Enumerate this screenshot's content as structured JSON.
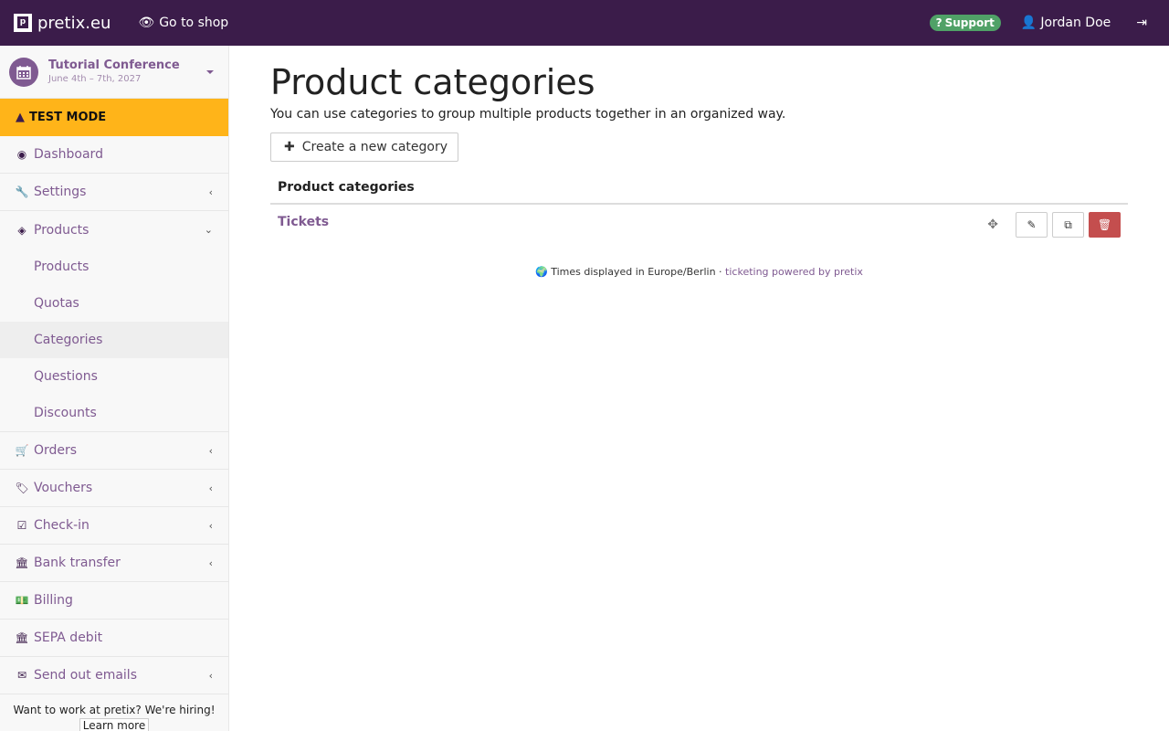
{
  "topbar": {
    "brand": "pretix.eu",
    "go_to_shop": "Go to shop",
    "support": "Support",
    "user": "Jordan Doe"
  },
  "event": {
    "name": "Tutorial Conference",
    "date": "June 4th – 7th, 2027"
  },
  "test_mode": "TEST MODE",
  "nav": {
    "dashboard": "Dashboard",
    "settings": "Settings",
    "products": "Products",
    "products_sub": [
      "Products",
      "Quotas",
      "Categories",
      "Questions",
      "Discounts"
    ],
    "orders": "Orders",
    "vouchers": "Vouchers",
    "checkin": "Check-in",
    "bank_transfer": "Bank transfer",
    "billing": "Billing",
    "sepa_debit": "SEPA debit",
    "send_emails": "Send out emails"
  },
  "hiring": {
    "text": "Want to work at pretix? We're hiring!",
    "button": "Learn more"
  },
  "main": {
    "title": "Product categories",
    "description": "You can use categories to group multiple products together in an organized way.",
    "create_button": "Create a new category",
    "table_header": "Product categories",
    "rows": [
      {
        "name": "Tickets"
      }
    ]
  },
  "footer": {
    "timezone": "Times displayed in Europe/Berlin",
    "separator": "·",
    "powered": "ticketing powered by pretix"
  }
}
